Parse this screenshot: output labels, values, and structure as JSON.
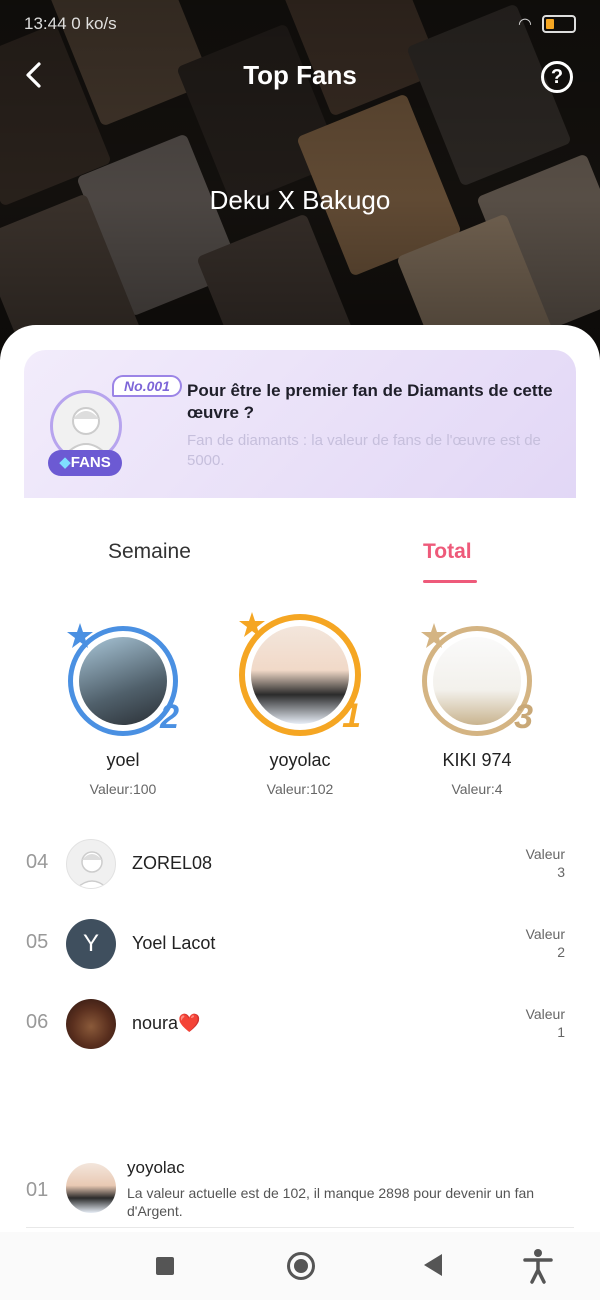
{
  "status_bar": {
    "time": "13:44",
    "speed": "0 ko/s",
    "battery": "27"
  },
  "header": {
    "title": "Top Fans",
    "book_title": "Deku X Bakugo"
  },
  "banner": {
    "badge": "No.001",
    "fans_label": "FANS",
    "title": "Pour être le premier fan de Diamants de cette œuvre ?",
    "subtitle": "Fan de diamants : la valeur de fans de l'œuvre est de 5000."
  },
  "tabs": [
    {
      "label": "Semaine",
      "active": false
    },
    {
      "label": "Total",
      "active": true
    }
  ],
  "podium": [
    {
      "rank": "2",
      "name": "yoel",
      "value": "Valeur:100",
      "ring_color": "#4a90e2"
    },
    {
      "rank": "1",
      "name": "yoyolac",
      "value": "Valeur:102",
      "ring_color": "#f5a623"
    },
    {
      "rank": "3",
      "name": "KIKI 974",
      "value": "Valeur:4",
      "ring_color": "#d4b483"
    }
  ],
  "list": [
    {
      "rank": "04",
      "name": "ZOREL08",
      "value_label": "Valeur",
      "value": "3",
      "avatar": "default"
    },
    {
      "rank": "05",
      "name": "Yoel Lacot",
      "value_label": "Valeur",
      "value": "2",
      "avatar": "Y"
    },
    {
      "rank": "06",
      "name": "noura❤️",
      "value_label": "Valeur",
      "value": "1",
      "avatar": "photo"
    }
  ],
  "me": {
    "rank": "01",
    "name": "yoyolac",
    "message": "La valeur actuelle est de 102, il manque 2898 pour devenir un fan d'Argent."
  },
  "colors": {
    "accent": "#ee5a7a",
    "purple": "#6c5ad3",
    "gold": "#f5a623",
    "blue": "#4a90e2"
  }
}
